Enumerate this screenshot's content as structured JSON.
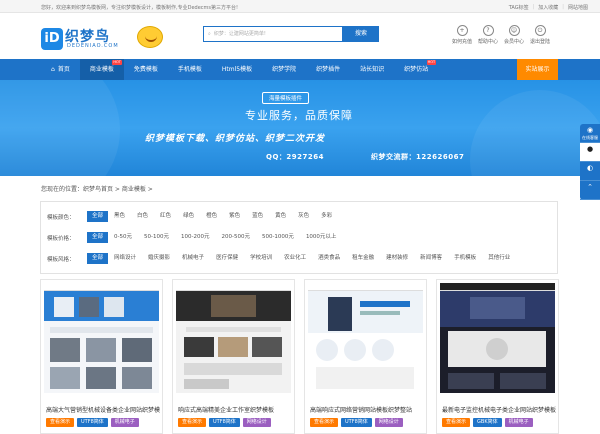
{
  "topbar": {
    "welcome": "您好，欢迎来到织梦鸟模板网，专注织梦模板设计，模板制作,专业Dedecms第三方平台!",
    "links": [
      "TAG标签",
      "加入收藏",
      "网站地图"
    ]
  },
  "logo": {
    "mark": "iD",
    "name": "织梦鸟",
    "en": "DEDENIAO.COM"
  },
  "search": {
    "placeholder": "织梦：让建网站更简单!",
    "button": "搜索"
  },
  "header_icons": [
    {
      "icon": "user-add-icon",
      "label": "如何充值"
    },
    {
      "icon": "help-icon",
      "label": "帮助中心"
    },
    {
      "icon": "member-icon",
      "label": "会员中心"
    },
    {
      "icon": "logout-icon",
      "label": "退出登陆"
    }
  ],
  "nav": {
    "items": [
      {
        "label": "首页",
        "active": false,
        "hot": false
      },
      {
        "label": "商业模板",
        "active": true,
        "hot": true
      },
      {
        "label": "免费模板",
        "active": false,
        "hot": false
      },
      {
        "label": "手机模板",
        "active": false,
        "hot": false
      },
      {
        "label": "Html5模板",
        "active": false,
        "hot": false
      },
      {
        "label": "织梦学院",
        "active": false,
        "hot": false
      },
      {
        "label": "织梦插件",
        "active": false,
        "hot": false
      },
      {
        "label": "站长知识",
        "active": false,
        "hot": false
      },
      {
        "label": "织梦仿站",
        "active": false,
        "hot": true
      }
    ],
    "hot_label": "HOT",
    "cta": "实站展示"
  },
  "banner": {
    "tag": "海量模板插件",
    "line1": "专业服务，品质保障",
    "line2": "织梦模板下载、织梦仿站、织梦二次开发",
    "qq": "QQ：2927264",
    "group": "织梦交流群：122626067"
  },
  "side_tools": [
    {
      "icon": "qq-icon",
      "label": "在线客服"
    },
    {
      "icon": "penguin-icon",
      "label": ""
    },
    {
      "icon": "wechat-icon",
      "label": ""
    },
    {
      "icon": "up-icon",
      "label": ""
    }
  ],
  "breadcrumb": "您现在的位置：织梦鸟首页 > 商业模板 >",
  "filters": [
    {
      "label": "模板颜色：",
      "options": [
        "全部",
        "黑色",
        "白色",
        "红色",
        "绿色",
        "橙色",
        "紫色",
        "蓝色",
        "黄色",
        "灰色",
        "多彩"
      ]
    },
    {
      "label": "模板价格：",
      "options": [
        "全部",
        "0-50元",
        "50-100元",
        "100-200元",
        "200-500元",
        "500-1000元",
        "1000元以上"
      ]
    },
    {
      "label": "模板风格：",
      "options": [
        "全部",
        "网络设计",
        "婚庆摄影",
        "机械电子",
        "医疗保健",
        "学校培训",
        "农业化工",
        "酒类食品",
        "租车金融",
        "建材装修",
        "新闻博客",
        "手机模板",
        "其他行业"
      ]
    }
  ],
  "cards": [
    {
      "title": "高端大气营销型机械设备类企业网站织梦模板",
      "tags": [
        "查看演示",
        "UTF8简体",
        "机械电子"
      ]
    },
    {
      "title": "响应式高端精美企业工作室织梦模板",
      "tags": [
        "查看演示",
        "UTF8简体",
        "网络设计"
      ]
    },
    {
      "title": "高端响应式网络营销网站模板织梦整站",
      "tags": [
        "查看演示",
        "UTF8简体",
        "网络设计"
      ]
    },
    {
      "title": "最新电子监控机械电子类企业网站织梦模板",
      "tags": [
        "查看演示",
        "GBK简体",
        "机械电子"
      ]
    }
  ]
}
